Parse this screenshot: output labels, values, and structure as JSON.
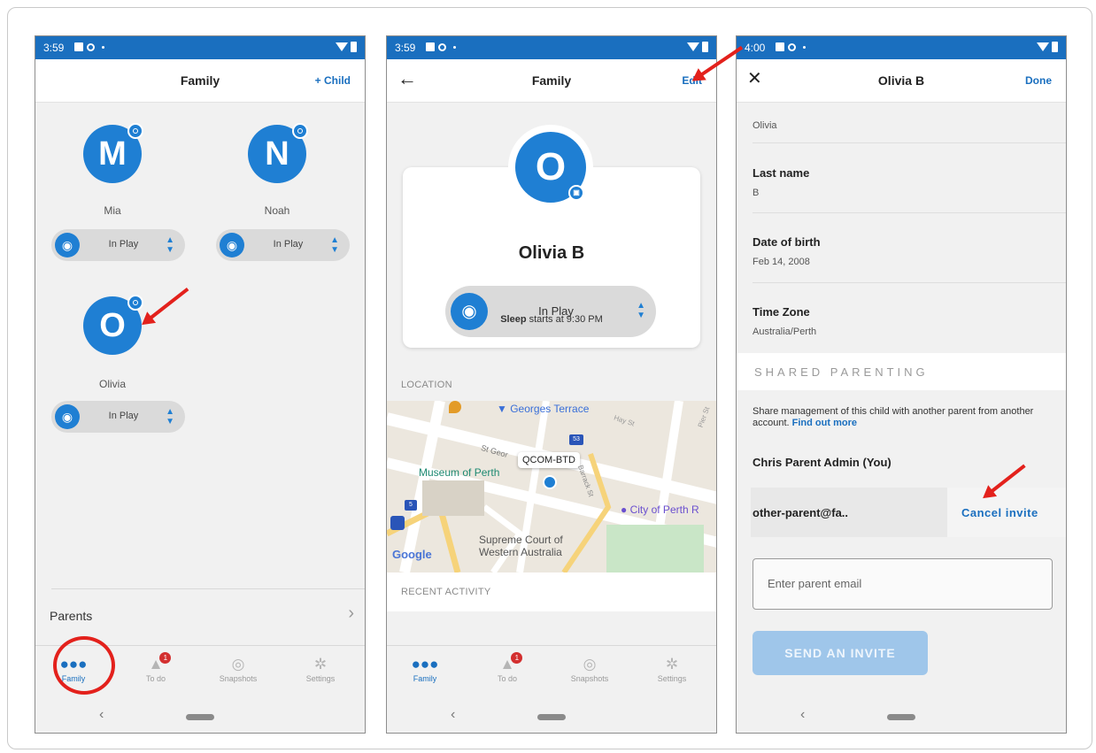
{
  "screen1": {
    "status_time": "3:59",
    "title": "Family",
    "action": "+ Child",
    "children": [
      {
        "initial": "M",
        "name": "Mia",
        "status": "In Play"
      },
      {
        "initial": "N",
        "name": "Noah",
        "status": "In Play"
      },
      {
        "initial": "O",
        "name": "Olivia",
        "status": "In Play"
      }
    ],
    "parents_label": "Parents",
    "nav": [
      "Family",
      "To do",
      "Snapshots",
      "Settings"
    ],
    "todo_badge": "1"
  },
  "screen2": {
    "status_time": "3:59",
    "title": "Family",
    "action": "Edit",
    "child_initial": "O",
    "child_name": "Olivia B",
    "status": "In Play",
    "sleep_bold": "Sleep",
    "sleep_rest": "starts at 9:30 PM",
    "location_label": "LOCATION",
    "map_labels": {
      "georges": "Georges Terrace",
      "hay": "Hay St",
      "pier": "Pier St",
      "stgeorge": "St Geor",
      "device": "QCOM-BTD",
      "museum": "Museum of Perth",
      "barrack": "Barrack St",
      "city": "City of Perth R",
      "supreme1": "Supreme Court of",
      "supreme2": "Western Australia",
      "google": "Google",
      "route53": "53",
      "route5": "5"
    },
    "recent_label": "RECENT ACTIVITY",
    "nav": [
      "Family",
      "To do",
      "Snapshots",
      "Settings"
    ],
    "todo_badge": "1"
  },
  "screen3": {
    "status_time": "4:00",
    "title": "Olivia B",
    "action": "Done",
    "first_name_value": "Olivia",
    "last_name_label": "Last name",
    "last_name_value": "B",
    "dob_label": "Date of birth",
    "dob_value": "Feb 14, 2008",
    "tz_label": "Time Zone",
    "tz_value": "Australia/Perth",
    "shared_header": "SHARED PARENTING",
    "shared_desc": "Share management of this child with another parent from another account.",
    "find_out_more": "Find out more",
    "admin": "Chris Parent Admin (You)",
    "invite_email": "other-parent@fa..",
    "cancel_invite": "Cancel invite",
    "email_placeholder": "Enter parent email",
    "send_invite": "SEND AN INVITE"
  },
  "colors": {
    "accent": "#1a6fbf",
    "avatar": "#1f7fd3",
    "annotation": "#e3211c"
  },
  "icons": [
    "wifi-icon",
    "battery-icon",
    "gear-icon",
    "controller-icon",
    "camera-icon",
    "back-arrow-icon",
    "close-icon",
    "family-icon",
    "bell-icon",
    "aperture-icon",
    "settings-icon",
    "map-pin-icon"
  ]
}
